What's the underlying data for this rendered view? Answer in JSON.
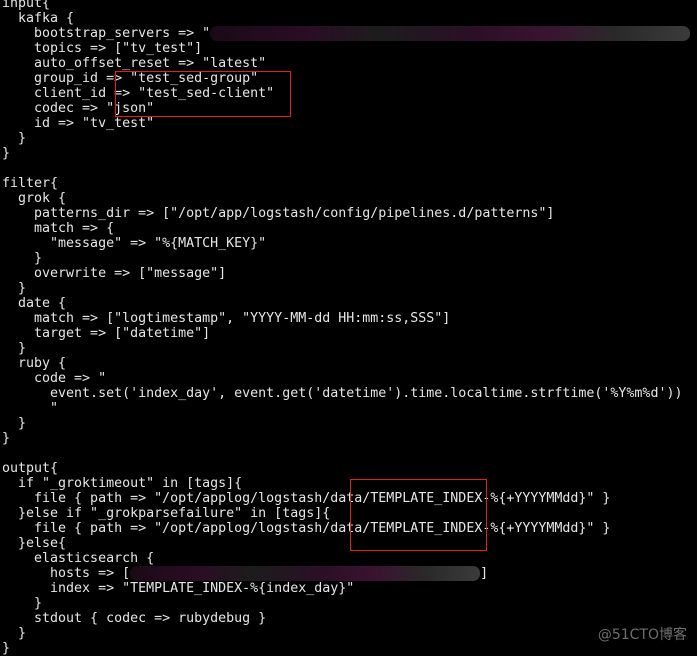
{
  "lines": [
    "input{",
    "  kafka {",
    "    bootstrap_servers => \"",
    "    topics => [\"tv_test\"]",
    "    auto_offset_reset => \"latest\"",
    "    group_id => \"test_sed-group\"",
    "    client_id => \"test_sed-client\"",
    "    codec => \"json\"",
    "    id => \"tv_test\"",
    "  }",
    "}",
    "",
    "filter{",
    "  grok {",
    "    patterns_dir => [\"/opt/app/logstash/config/pipelines.d/patterns\"]",
    "    match => {",
    "      \"message\" => \"%{MATCH_KEY}\"",
    "    }",
    "    overwrite => [\"message\"]",
    "  }",
    "  date {",
    "    match => [\"logtimestamp\", \"YYYY-MM-dd HH:mm:ss,SSS\"]",
    "    target => [\"datetime\"]",
    "  }",
    "  ruby {",
    "    code => \"",
    "      event.set('index_day', event.get('datetime').time.localtime.strftime('%Y%m%d'))",
    "      \"",
    "  }",
    "}",
    "",
    "output{",
    "  if \"_groktimeout\" in [tags]{",
    "    file { path => \"/opt/applog/logstash/data/TEMPLATE_INDEX-%{+YYYYMMdd}\" }",
    "  }else if \"_grokparsefailure\" in [tags]{",
    "    file { path => \"/opt/applog/logstash/data/TEMPLATE_INDEX-%{+YYYYMMdd}\" }",
    "  }else{",
    "    elasticsearch {",
    "      hosts => [",
    "      index => \"TEMPLATE_INDEX-%{index_day}\"",
    "    }",
    "    stdout { codec => rubydebug }",
    "  }",
    "}"
  ],
  "hosts_suffix": "]",
  "watermark": "@51CTO博客",
  "colors": {
    "background": "#000000",
    "text": "#e6e6e6",
    "highlight_box": "#e0201e"
  }
}
